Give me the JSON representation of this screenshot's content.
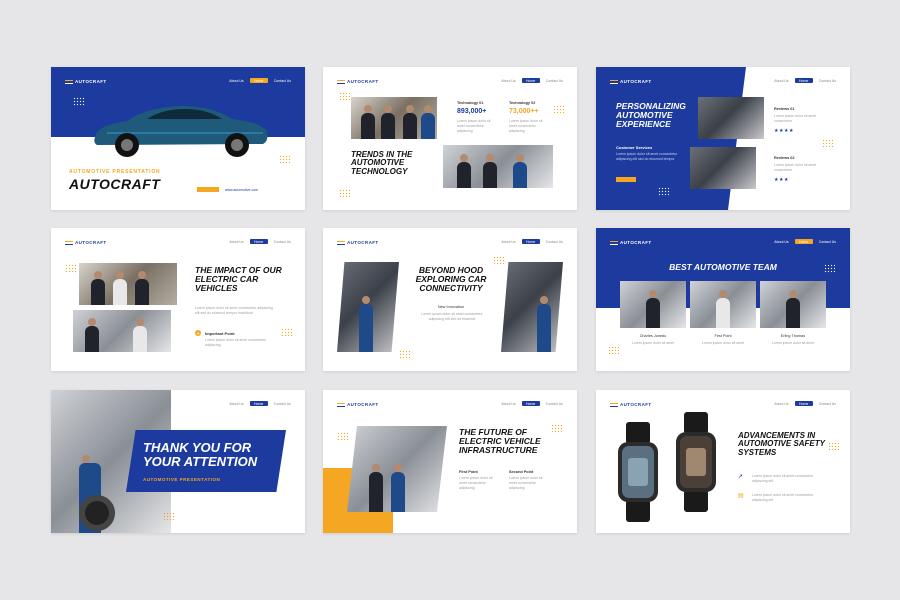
{
  "brand": "AUTOCRAFT",
  "nav": {
    "about": "About Us",
    "home": "Home",
    "contact": "Contact Us"
  },
  "colors": {
    "primary": "#1d3b9e",
    "accent": "#f5a623"
  },
  "slide1": {
    "kicker": "AUTOMOTIVE PRESENTATION",
    "title": "AUTOCRAFT",
    "link": "www.automotive.com"
  },
  "slide2": {
    "title": "TRENDS IN THE AUTOMOTIVE TECHNOLOGY",
    "tech1_label": "Technology 01",
    "tech1_value": "893,000+",
    "tech2_label": "Technology 02",
    "tech2_value": "73,000++"
  },
  "slide3": {
    "title": "PERSONALIZING AUTOMOTIVE EXPERIENCE",
    "subhead": "Customer Services",
    "review1": "Reviews 01",
    "review2": "Reviews 02",
    "stars1": "★★★★",
    "stars2": "★★★"
  },
  "slide4": {
    "title": "THE IMPACT OF OUR ELECTRIC CAR VEHICLES",
    "point": "Important Point"
  },
  "slide5": {
    "title": "BEYOND HOOD EXPLORING CAR CONNECTIVITY",
    "subhead": "New Innovation"
  },
  "slide6": {
    "title": "BEST AUTOMOTIVE TEAM",
    "members": [
      "Charles Junedo",
      "First Point",
      "Erling Thomas"
    ]
  },
  "slide7": {
    "title": "THANK YOU FOR YOUR ATTENTION",
    "subtitle": "AUTOMOTIVE PRESENTATION"
  },
  "slide8": {
    "title": "THE FUTURE OF ELECTRIC VEHICLE INFRASTRUCTURE",
    "point1": "First Point",
    "point2": "Second Point"
  },
  "slide9": {
    "title": "ADVANCEMENTS IN AUTOMOTIVE SAFETY SYSTEMS"
  },
  "icons": [
    "car-illustration",
    "star-icon",
    "bulb-icon",
    "rocket-icon",
    "document-icon",
    "watch-illustration"
  ]
}
